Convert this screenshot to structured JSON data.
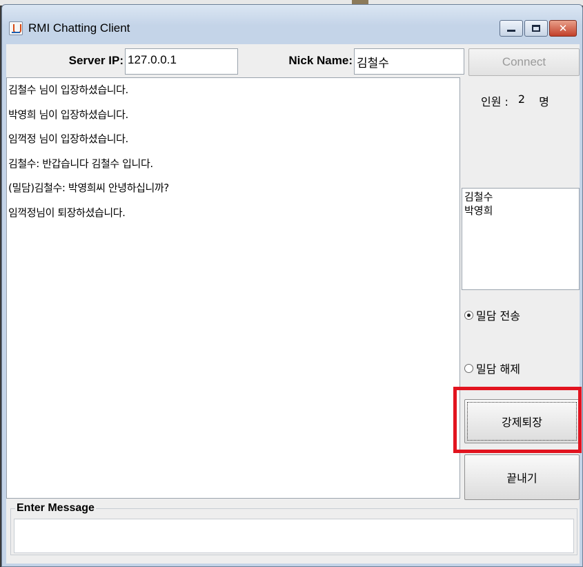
{
  "window": {
    "title": "RMI Chatting Client",
    "close_glyph": "✕"
  },
  "connection": {
    "server_ip_label": "Server IP:",
    "server_ip_value": "127.0.0.1",
    "nick_label": "Nick Name:",
    "nick_value": "김철수",
    "connect_label": "Connect"
  },
  "chat": {
    "lines": [
      "김철수 님이 입장하셨습니다.",
      "박영희 님이 입장하셨습니다.",
      "임꺽정 님이 입장하셨습니다.",
      "김철수: 반갑습니다 김철수 입니다.",
      "(밀담)김철수: 박영희씨 안녕하십니까?",
      "임꺽정님이 퇴장하셨습니다."
    ]
  },
  "side": {
    "count_label": "인원 :",
    "count_value": "2",
    "count_unit": "명",
    "users": [
      "김철수",
      "박영희"
    ],
    "whisper_send_label": "밀담 전송",
    "whisper_cancel_label": "밀담 해제",
    "whisper_send_selected": true,
    "kick_label": "강제퇴장",
    "exit_label": "끝내기"
  },
  "message": {
    "legend": "Enter Message",
    "value": ""
  },
  "colors": {
    "highlight": "#e2141f"
  }
}
